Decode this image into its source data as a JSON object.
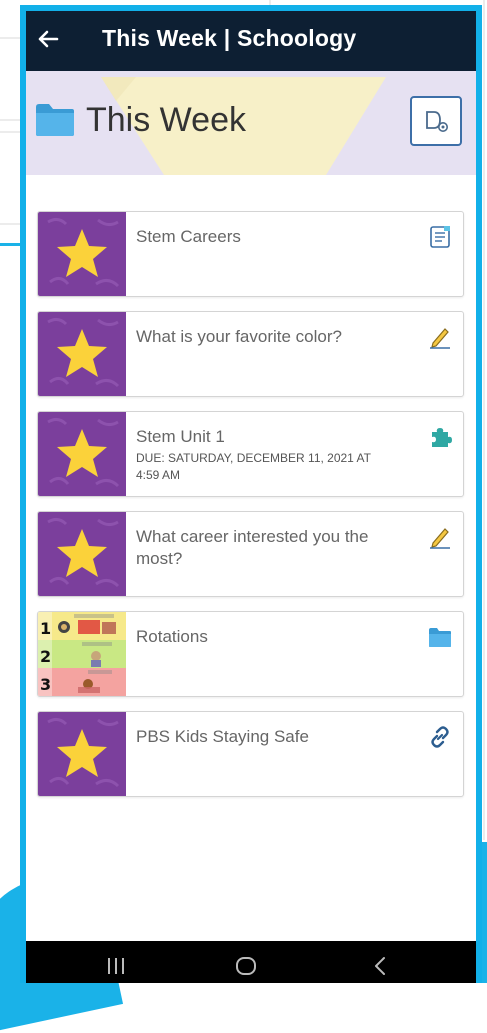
{
  "app": {
    "title": "This Week | Schoology"
  },
  "header": {
    "page_title": "This Week",
    "accent": "#0d1f33",
    "banner_color": "#e6e1f2"
  },
  "items": [
    {
      "title": "Stem Careers",
      "due": "",
      "icon": "document-icon",
      "thumb": "star"
    },
    {
      "title": "What is your favorite color?",
      "due": "",
      "icon": "pencil-icon",
      "thumb": "star"
    },
    {
      "title": "Stem Unit 1",
      "due": "DUE: SATURDAY, DECEMBER 11, 2021 AT 4:59 AM",
      "icon": "puzzle-icon",
      "thumb": "star"
    },
    {
      "title": "What career interested you the most?",
      "due": "",
      "icon": "pencil-icon",
      "thumb": "star"
    },
    {
      "title": "Rotations",
      "due": "",
      "icon": "folder-icon",
      "thumb": "rotations-chart"
    },
    {
      "title": "PBS Kids Staying Safe",
      "due": "",
      "icon": "link-icon",
      "thumb": "star"
    }
  ],
  "navbar": {
    "icons": [
      "recent-apps-icon",
      "home-icon",
      "back-icon"
    ]
  },
  "colors": {
    "frame": "#12b0e9",
    "thumb_purple": "#7b3f9c",
    "star_yellow": "#fbd23a"
  }
}
